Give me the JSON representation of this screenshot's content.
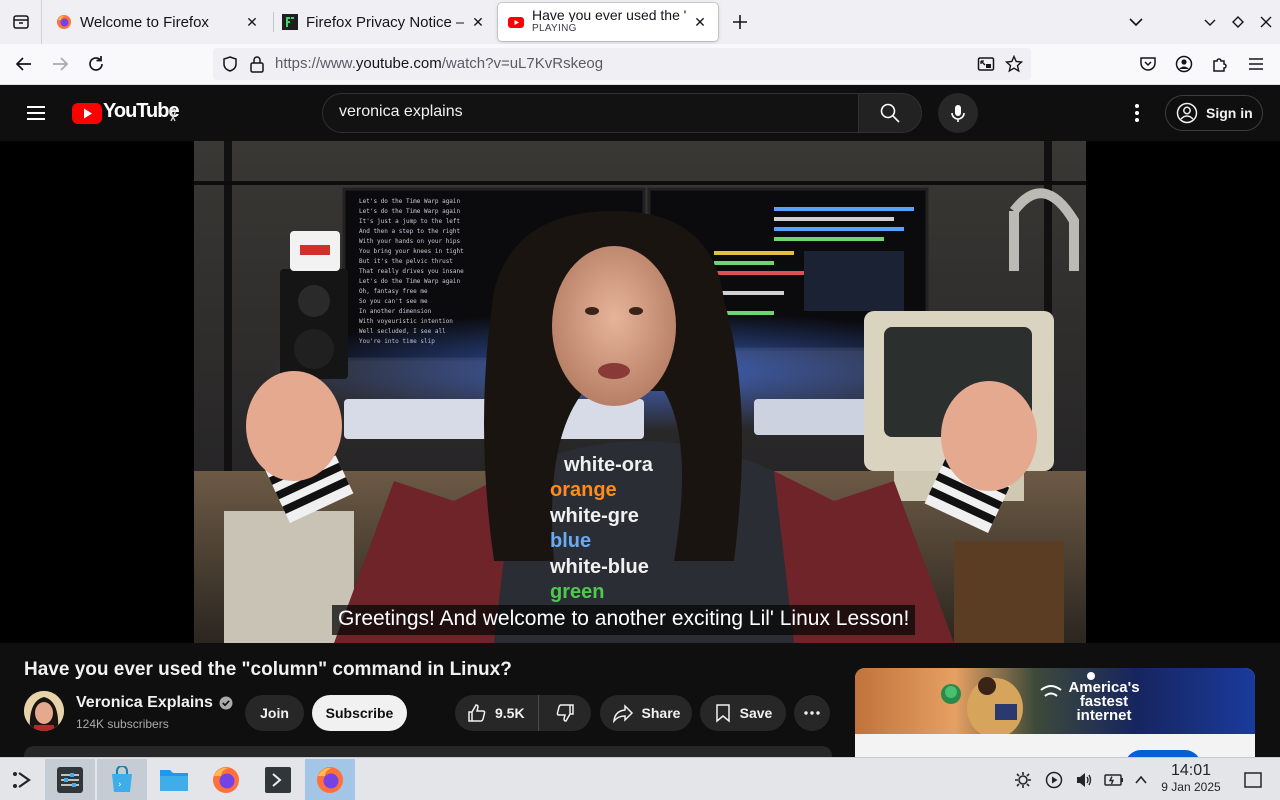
{
  "browser": {
    "tabs": [
      {
        "title": "Welcome to Firefox",
        "status": ""
      },
      {
        "title": "Firefox Privacy Notice — M",
        "status": ""
      },
      {
        "title": "Have you ever used the \"co",
        "status": "PLAYING"
      }
    ],
    "url_prefix": "https://www.",
    "url_domain": "youtube.com",
    "url_suffix": "/watch?v=uL7KvRskeog"
  },
  "youtube": {
    "logo_text": "YouTube",
    "search_value": "veronica explains",
    "sign_in_label": "Sign in",
    "caption": "Greetings! And welcome to another exciting Lil' Linux Lesson!",
    "video_title": "Have you ever used the \"column\" command in Linux?",
    "channel_name": "Veronica Explains",
    "subscribers": "124K subscribers",
    "join_label": "Join",
    "subscribe_label": "Subscribe",
    "like_count": "9.5K",
    "share_label": "Share",
    "save_label": "Save",
    "ad_text": "America's fastest internet"
  },
  "shirt_text": [
    "white-ora",
    "orange",
    "white-gre",
    "blue",
    "white-blue",
    "green"
  ],
  "taskbar": {
    "time": "14:01",
    "date": "9 Jan 2025"
  },
  "colors": {
    "youtube_red": "#ff0000",
    "firefox_orange": "#ff7139",
    "youtube_bg": "#0f0f0f"
  }
}
